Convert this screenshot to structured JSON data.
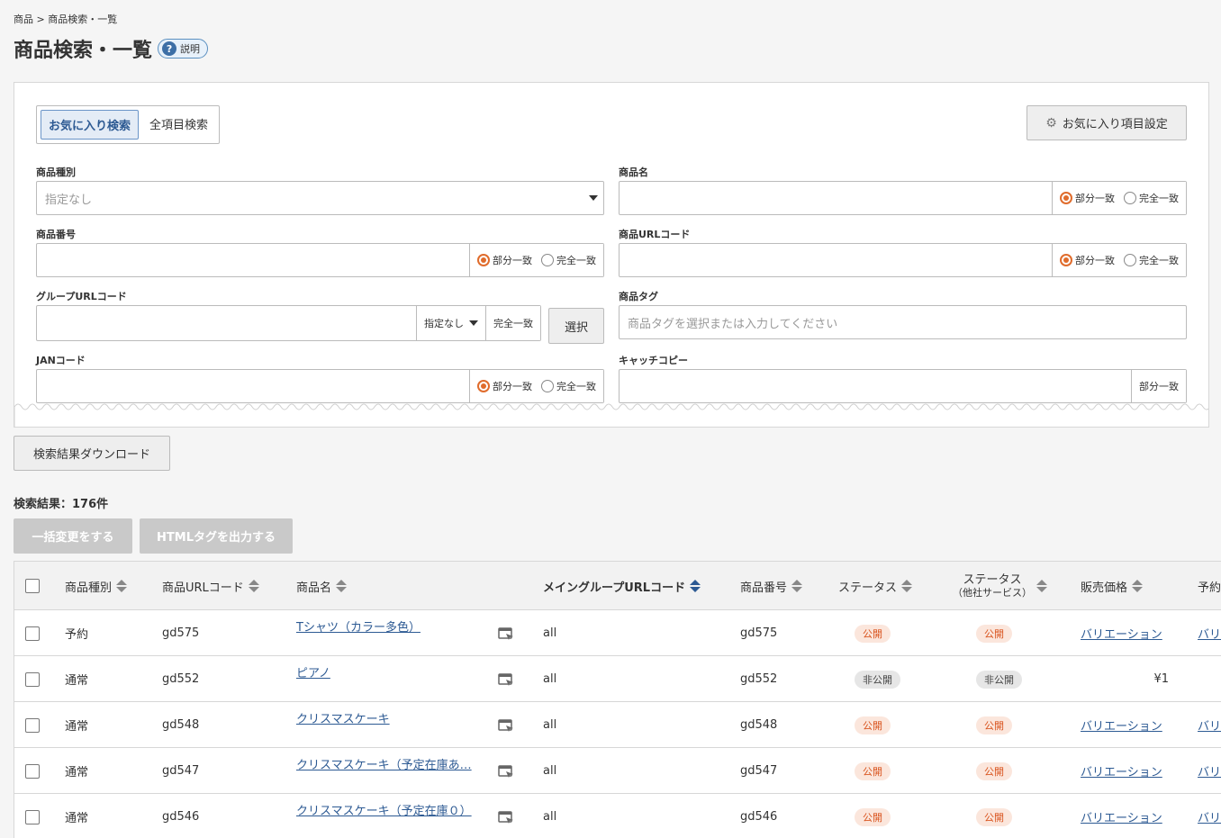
{
  "breadcrumb": "商品 > 商品検索・一覧",
  "page_title": "商品検索・一覧",
  "help_label": "説明",
  "search": {
    "tab_favorite": "お気に入り検索",
    "tab_all": "全項目検索",
    "fav_settings_label": "お気に入り項目設定",
    "partial_match": "部分一致",
    "exact_match": "完全一致",
    "product_type": {
      "label": "商品種別",
      "value": "指定なし"
    },
    "product_name": {
      "label": "商品名"
    },
    "product_number": {
      "label": "商品番号"
    },
    "product_url_code": {
      "label": "商品URLコード"
    },
    "group_url_code": {
      "label": "グループURLコード",
      "select_value": "指定なし",
      "match_label": "完全一致",
      "select_button": "選択"
    },
    "product_tag": {
      "label": "商品タグ",
      "placeholder": "商品タグを選択または入力してください"
    },
    "jan_code": {
      "label": "JANコード"
    },
    "catch_copy": {
      "label": "キャッチコピー",
      "match_label": "部分一致"
    }
  },
  "download_label": "検索結果ダウンロード",
  "result_count": "検索結果：176件",
  "bulk_change_label": "一括変更をする",
  "html_tag_label": "HTMLタグを出力する",
  "table": {
    "headers": {
      "type": "商品種別",
      "url_code": "商品URLコード",
      "name": "商品名",
      "main_group": "メイングループURLコード",
      "number": "商品番号",
      "status": "ステータス",
      "status_other": "ステータス",
      "status_other_sub": "（他社サービス）",
      "price": "販売価格",
      "reserve": "予約"
    },
    "rows": [
      {
        "type": "予約",
        "url_code": "gd575",
        "name": "Tシャツ（カラー多色）",
        "group": "all",
        "number": "gd575",
        "status": "公開",
        "status_other": "公開",
        "price": "バリエーション",
        "reserve": "バリ"
      },
      {
        "type": "通常",
        "url_code": "gd552",
        "name": "ピアノ",
        "group": "all",
        "number": "gd552",
        "status": "非公開",
        "status_other": "非公開",
        "price": "¥1",
        "reserve": ""
      },
      {
        "type": "通常",
        "url_code": "gd548",
        "name": "クリスマスケーキ",
        "group": "all",
        "number": "gd548",
        "status": "公開",
        "status_other": "公開",
        "price": "バリエーション",
        "reserve": "バリ"
      },
      {
        "type": "通常",
        "url_code": "gd547",
        "name": "クリスマスケーキ（予定在庫あ…",
        "group": "all",
        "number": "gd547",
        "status": "公開",
        "status_other": "公開",
        "price": "バリエーション",
        "reserve": "バリ"
      },
      {
        "type": "通常",
        "url_code": "gd546",
        "name": "クリスマスケーキ（予定在庫０）",
        "group": "all",
        "number": "gd546",
        "status": "公開",
        "status_other": "公開",
        "price": "バリエーション",
        "reserve": "バリ"
      }
    ]
  }
}
